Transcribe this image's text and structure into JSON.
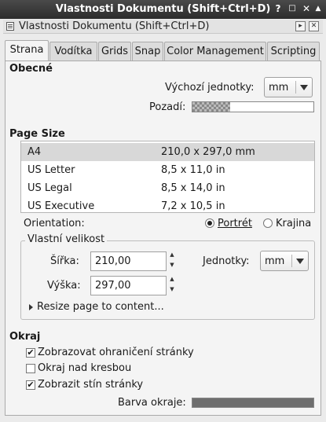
{
  "window": {
    "title": "Vlastnosti Dokumentu (Shift+Ctrl+D)"
  },
  "dock": {
    "title": "Vlastnosti Dokumentu (Shift+Ctrl+D)"
  },
  "tabs": [
    {
      "label": "Strana"
    },
    {
      "label": "Vodítka"
    },
    {
      "label": "Grids"
    },
    {
      "label": "Snap"
    },
    {
      "label": "Color Management"
    },
    {
      "label": "Scripting"
    }
  ],
  "general": {
    "heading": "Obecné",
    "default_units_label": "Výchozí jednotky:",
    "default_units_value": "mm",
    "background_label": "Pozadí:"
  },
  "page_size": {
    "heading": "Page Size",
    "rows": [
      {
        "name": "A4",
        "size": "210,0 x 297,0 mm"
      },
      {
        "name": "US Letter",
        "size": "8,5 x 11,0 in"
      },
      {
        "name": "US Legal",
        "size": "8,5 x 14,0 in"
      },
      {
        "name": "US Executive",
        "size": "7,2 x 10,5 in"
      }
    ],
    "selected_index": 0,
    "orientation_label": "Orientation:",
    "portrait_label": "Portrét",
    "landscape_label": "Krajina",
    "orientation_selected": "Portrét"
  },
  "custom_size": {
    "title": "Vlastní velikost",
    "width_label": "Šířka:",
    "width_value": "210,00",
    "height_label": "Výška:",
    "height_value": "297,00",
    "units_label": "Jednotky:",
    "units_value": "mm",
    "resize_label": "Resize page to content..."
  },
  "border": {
    "heading": "Okraj",
    "show_border_label": "Zobrazovat ohraničení stránky",
    "show_border_checked": true,
    "border_on_top_label": "Okraj nad kresbou",
    "border_on_top_checked": false,
    "show_shadow_label": "Zobrazit stín stránky",
    "show_shadow_checked": true,
    "border_color_label": "Barva okraje:",
    "border_color": "#6e6e6e"
  }
}
